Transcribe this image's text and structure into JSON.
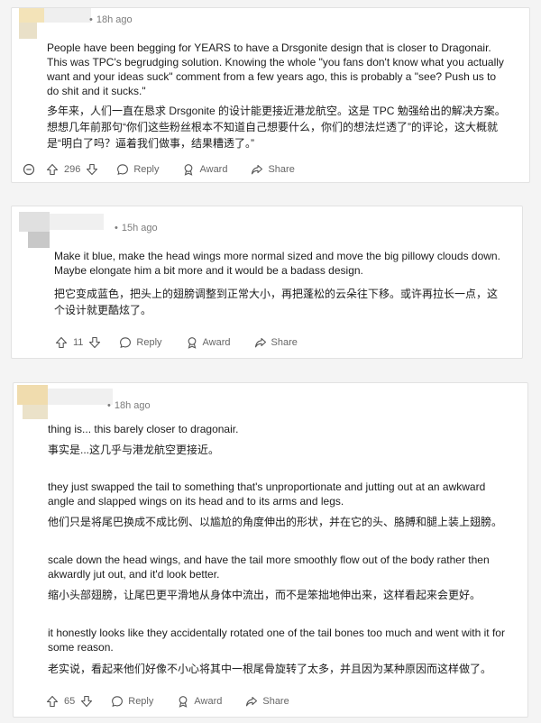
{
  "comments": [
    {
      "time": "18h ago",
      "paragraphs": [
        "People have been begging for YEARS to have a Drsgonite design that is closer to Dragonair. This was TPC's begrudging solution. Knowing the whole \"you fans don't know what you actually want and your ideas suck\" comment from a few years ago, this is probably a \"see? Push us to do shit and it sucks.\"",
        "多年来，人们一直在恳求 Drsgonite 的设计能更接近港龙航空。这是 TPC 勉强给出的解决方案。想想几年前那句“你们这些粉丝根本不知道自己想要什么，你们的想法烂透了”的评论，这大概就是“明白了吗？逼着我们做事，结果糟透了。”"
      ],
      "votes": "296",
      "reply": "Reply",
      "award": "Award",
      "share": "Share"
    },
    {
      "time": "15h ago",
      "paragraphs": [
        "Make it blue, make the head wings more normal sized and move the big pillowy clouds down. Maybe elongate him a bit more and it would be a badass design.",
        "把它变成蓝色，把头上的翅膀调整到正常大小，再把蓬松的云朵往下移。或许再拉长一点，这个设计就更酷炫了。"
      ],
      "votes": "11",
      "reply": "Reply",
      "award": "Award",
      "share": "Share"
    },
    {
      "time": "18h ago",
      "paragraphs": [
        "thing is... this barely closer to dragonair.",
        "事实是...这几乎与港龙航空更接近。",
        "they just swapped the tail to something that's unproportionate and jutting out at an awkward angle and slapped wings on its head and to its arms and legs.",
        "他们只是将尾巴换成不成比例、以尴尬的角度伸出的形状，并在它的头、胳膊和腿上装上翅膀。",
        "scale down the head wings, and have the tail more smoothly flow out of the body rather then akwardly jut out, and it'd look better.",
        "缩小头部翅膀，让尾巴更平滑地从身体中流出，而不是笨拙地伸出来，这样看起来会更好。",
        "it honestly looks like they accidentally rotated one of the tail bones too much and went with it for some reason.",
        "老实说，看起来他们好像不小心将其中一根尾骨旋转了太多，并且因为某种原因而这样做了。"
      ],
      "votes": "65",
      "reply": "Reply",
      "award": "Award",
      "share": "Share"
    }
  ],
  "colors": {
    "avatar_1": "#f3e3b8",
    "avatar_2": "#c8c8c8",
    "avatar_3": "#f0dcae"
  },
  "icons": [
    "collapse-icon",
    "upvote-icon",
    "downvote-icon",
    "reply-icon",
    "award-icon",
    "share-icon"
  ]
}
